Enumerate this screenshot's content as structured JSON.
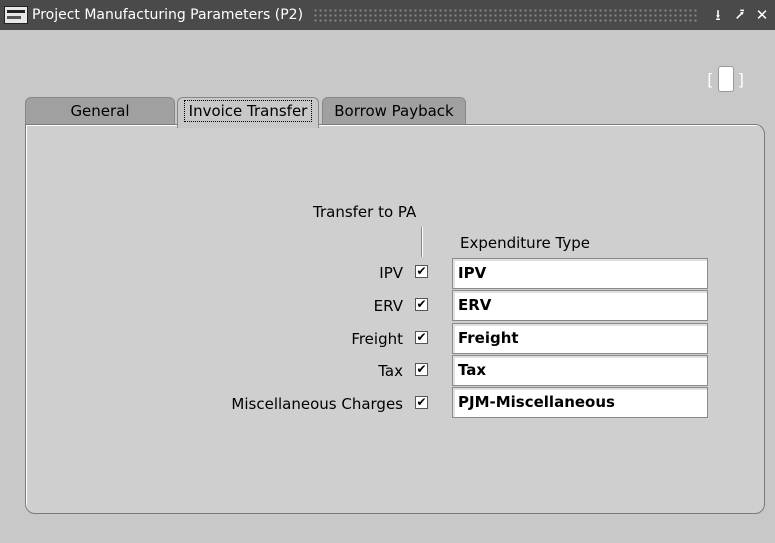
{
  "window": {
    "title": "Project Manufacturing Parameters (P2)",
    "controls": [
      "minimize-icon",
      "maximize-icon",
      "close-icon"
    ]
  },
  "tabs": [
    {
      "label": "General",
      "active": false
    },
    {
      "label": "Invoice Transfer",
      "active": true
    },
    {
      "label": "Borrow Payback",
      "active": false
    }
  ],
  "form": {
    "transfer_header": "Transfer to PA",
    "expenditure_header": "Expenditure Type",
    "rows": [
      {
        "label": "IPV",
        "checked": true,
        "value": "IPV"
      },
      {
        "label": "ERV",
        "checked": true,
        "value": "ERV"
      },
      {
        "label": "Freight",
        "checked": true,
        "value": "Freight"
      },
      {
        "label": "Tax",
        "checked": true,
        "value": "Tax"
      },
      {
        "label": "Miscellaneous Charges",
        "checked": true,
        "value": "PJM-Miscellaneous"
      }
    ]
  },
  "toolbar": {
    "bracket_left": "[",
    "bracket_right": "]"
  }
}
